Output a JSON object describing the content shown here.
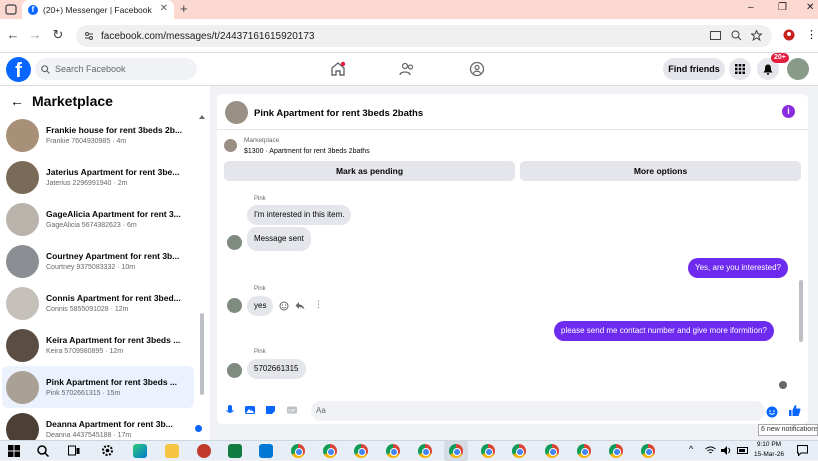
{
  "browser": {
    "tab_title": "(20+) Messenger | Facebook",
    "new_tab": "+",
    "close_tab": "✕",
    "url": "facebook.com/messages/t/24437161615920173",
    "window_min": "–",
    "window_max": "❐",
    "window_close": "✕"
  },
  "fb_header": {
    "search_placeholder": "Search Facebook",
    "find_friends": "Find friends",
    "notifications_badge": "20+"
  },
  "sidebar": {
    "title": "Marketplace",
    "items": [
      {
        "name": "Frankie house for rent 3beds 2b...",
        "sub": "Frankie 7604930985 · 4m",
        "thumb": "#a88f77"
      },
      {
        "name": "Jaterius Apartment for rent 3be...",
        "sub": "Jaterius 2296991940 · 2m",
        "thumb": "#7a6a58"
      },
      {
        "name": "GageAlicia Apartment for rent 3...",
        "sub": "GageAlicia 5674382623 · 6m",
        "thumb": "#b9b3ab"
      },
      {
        "name": "Courtney Apartment for rent 3b...",
        "sub": "Courtney 9375083332 · 10m",
        "thumb": "#8b8f93"
      },
      {
        "name": "Connis Apartment for rent 3bed...",
        "sub": "Connis 5855091028 · 12m",
        "thumb": "#c5c0ba"
      },
      {
        "name": "Keira Apartment for rent 3beds ...",
        "sub": "Keira 5709980895 · 12m",
        "thumb": "#5a4d44"
      },
      {
        "name": "Pink Apartment for rent 3beds ...",
        "sub": "Pink 5702661315 · 15m",
        "thumb": "#a9a096"
      },
      {
        "name": "Deanna Apartment for rent 3b...",
        "sub": "Deanna 4437545188 · 17m",
        "thumb": "#4b3f36"
      }
    ]
  },
  "chat": {
    "title": "Pink Apartment for rent 3beds 2baths",
    "info_icon": "i",
    "marketplace_label": "Marketplace",
    "listing_detail": "$1300 · Apartment for rent 3beds 2baths",
    "mark_pending": "Mark as pending",
    "more_options": "More options",
    "messages": {
      "sender1": "Pink",
      "m1": "I'm interested in this item.",
      "m2": "Message sent",
      "m3": "Yes, are you interested?",
      "sender2": "Pink",
      "m4": "yes",
      "m5": "please send me contact number and give more iformition?",
      "sender3": "Pink",
      "m6": "5702661315"
    },
    "composer_placeholder": "Aa"
  },
  "toast": "6 new notifications",
  "taskbar": {
    "time": "9:10 PM",
    "date": "15-Mar-26"
  }
}
